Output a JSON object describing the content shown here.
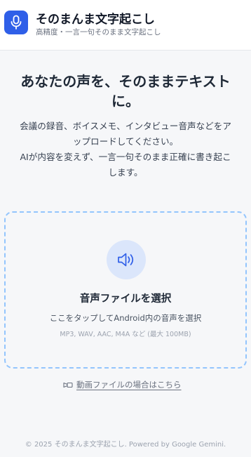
{
  "header": {
    "app_title": "そのまんま文字起こし",
    "app_subtitle": "高精度・一言一句そのまま文字起こし",
    "logo_icon": "microphone-icon",
    "accent_color": "#2f5fe8"
  },
  "hero": {
    "headline_line1": "あなたの声を、そのままテキスト",
    "headline_line2": "に。",
    "desc_line1": "会議の録音、ボイスメモ、インタビュー音声などをア",
    "desc_line2": "ップロードしてください。",
    "desc_line3": "AIが内容を変えず、一言一句そのまま正確に書き起こ",
    "desc_line4": "します。"
  },
  "upload": {
    "icon": "speaker-icon",
    "title": "音声ファイルを選択",
    "subtitle": "ここをタップしてAndroid内の音声を選択",
    "formats": "MP3, WAV, AAC, M4A など (最大 100MB)"
  },
  "video_link": {
    "icon": "video-camera-icon",
    "label": "動画ファイルの場合はこちら"
  },
  "footer": {
    "text": "© 2025 そのまんま文字起こし. Powered by Google Gemini."
  }
}
